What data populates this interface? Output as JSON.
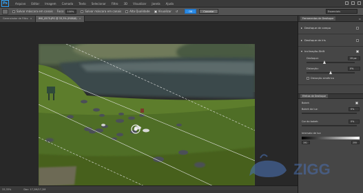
{
  "app": {
    "logo": "Ps",
    "menu": [
      "Arquivo",
      "Editar",
      "Imagem",
      "Camada",
      "Texto",
      "Selecionar",
      "Filtro",
      "3D",
      "Visualizar",
      "Janela",
      "Ajuda"
    ]
  },
  "options_bar": {
    "save_selection_label": "Salvar máscara em canais",
    "focus_label": "Foco:",
    "focus_value": "100%",
    "save_mask_label": "Salvar máscara em canais",
    "high_quality_label": "Alta Qualidade",
    "preview_label": "Visualizar",
    "ok_label": "OK",
    "cancel_label": "Cancelar",
    "workspace": "Essenciais"
  },
  "tabs": [
    {
      "label": "Gerenciador de Filtro",
      "active": false
    },
    {
      "label": "IMG_0575.JPG @ 33,3% (RGB/8)",
      "active": true
    }
  ],
  "status": {
    "zoom": "33,33%",
    "doc": "Doc: 17,2M/17,2M"
  },
  "panel": {
    "tab": "Ferramentas de Desfoque",
    "blurs": [
      {
        "label": "Desfoque de campo",
        "open": false
      },
      {
        "label": "Desfoque de íris",
        "open": false
      },
      {
        "label": "Inclinação-Shift",
        "open": true
      }
    ],
    "tilt_params": {
      "blur_label": "Desfoque:",
      "blur_value": "15 px",
      "distortion_label": "Distorção:",
      "distortion_value": "0%",
      "symmetric_label": "Distorção simétrica"
    },
    "effects_tab": "Efeitos de Desfoque",
    "bokeh_label": "Bokeh",
    "light_bokeh_label": "Bokeh da luz:",
    "light_bokeh_value": "0%",
    "bokeh_color_label": "Cor do bokeh:",
    "bokeh_color_value": "0%",
    "light_range_label": "Intervalo de luz:",
    "range_low": "191",
    "range_high": "255"
  },
  "watermark": {
    "text": "ZIGG"
  },
  "colors": {
    "accent": "#2b8be6",
    "panel_bg": "#464646",
    "chrome": "#3a3a3a"
  }
}
